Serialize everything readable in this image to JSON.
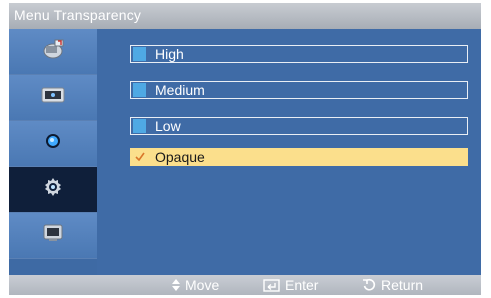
{
  "title": "Menu Transparency",
  "sidebar": {
    "items": [
      {
        "icon": "picture-icon",
        "selected": false
      },
      {
        "icon": "sound-icon",
        "selected": false
      },
      {
        "icon": "setup-icon",
        "selected": false
      },
      {
        "icon": "input-icon",
        "selected": true
      },
      {
        "icon": "pc-display-icon",
        "selected": false
      }
    ]
  },
  "options": [
    {
      "label": "High",
      "selected": false
    },
    {
      "label": "Medium",
      "selected": false
    },
    {
      "label": "Low",
      "selected": false
    },
    {
      "label": "Opaque",
      "selected": true
    }
  ],
  "footer": {
    "move_label": "Move",
    "enter_label": "Enter",
    "return_label": "Return"
  },
  "colors": {
    "accent": "#fbdf8c",
    "background": "#3e6aa4",
    "swatch": "#4fa9e4"
  }
}
